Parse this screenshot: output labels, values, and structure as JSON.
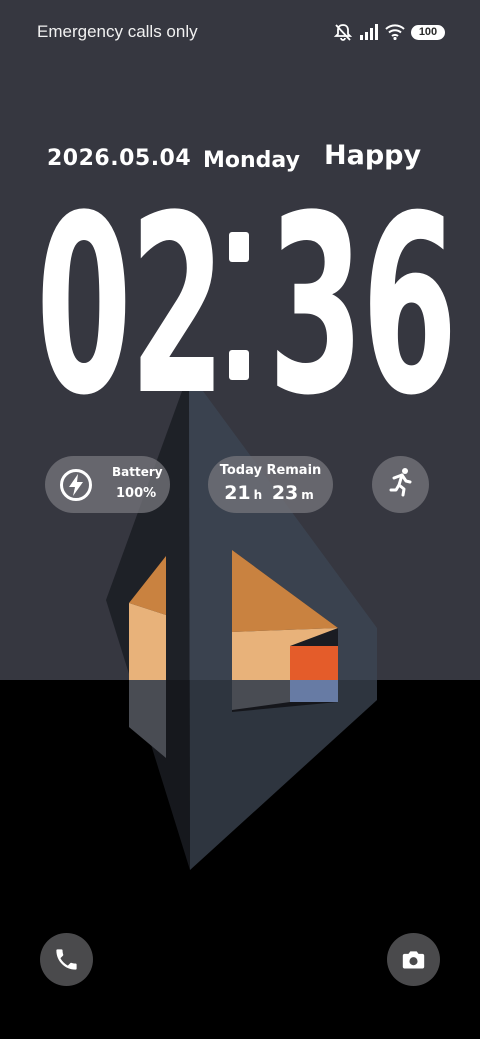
{
  "status_bar": {
    "carrier_text": "Emergency calls only",
    "icons": [
      "silent-bell-icon",
      "signal-icon",
      "wifi-icon",
      "battery-icon"
    ],
    "battery_level": "100"
  },
  "lock_screen": {
    "date": "2026.05.04",
    "weekday": "Monday",
    "greeting": "Happy",
    "time": {
      "hours": "02",
      "minutes": "36"
    }
  },
  "widgets": {
    "battery": {
      "label": "Battery",
      "value": "100%",
      "icon": "charging-bolt-icon"
    },
    "today_remain": {
      "label": "Today Remain",
      "hours": "21",
      "hours_unit": "h",
      "minutes": "23",
      "minutes_unit": "m"
    },
    "activity": {
      "icon": "running-person-icon"
    }
  },
  "shortcuts": {
    "left": {
      "icon": "phone-icon"
    },
    "right": {
      "icon": "camera-icon"
    }
  },
  "colors": {
    "wallpaper_top": "#363740",
    "wallpaper_bottom": "#000000",
    "widget_bg": "#73737a",
    "accent_orange": "#c98240",
    "accent_peach": "#e8b27a",
    "accent_red": "#e45c2a",
    "accent_blue": "#7e97c9"
  }
}
